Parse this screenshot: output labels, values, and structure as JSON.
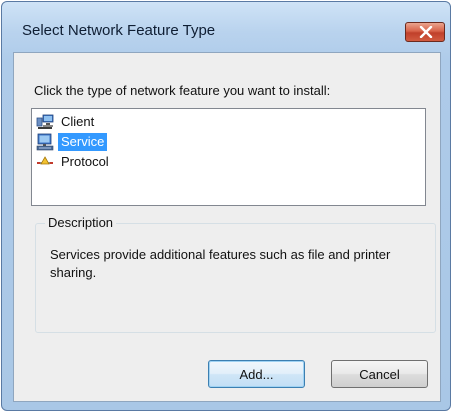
{
  "window": {
    "title": "Select Network Feature Type",
    "close_icon": "close-icon"
  },
  "prompt": "Click the type of network feature you want to install:",
  "feature_list": {
    "items": [
      {
        "label": "Client",
        "icon": "client-network-icon",
        "selected": false
      },
      {
        "label": "Service",
        "icon": "service-network-icon",
        "selected": true
      },
      {
        "label": "Protocol",
        "icon": "protocol-network-icon",
        "selected": false
      }
    ]
  },
  "description": {
    "legend": "Description",
    "text": "Services provide additional features such as file and printer sharing."
  },
  "buttons": {
    "add_label": "Add...",
    "cancel_label": "Cancel"
  },
  "colors": {
    "selection": "#3399ff",
    "title_bar": "#b9d3ee",
    "close_button": "#d15b40"
  }
}
